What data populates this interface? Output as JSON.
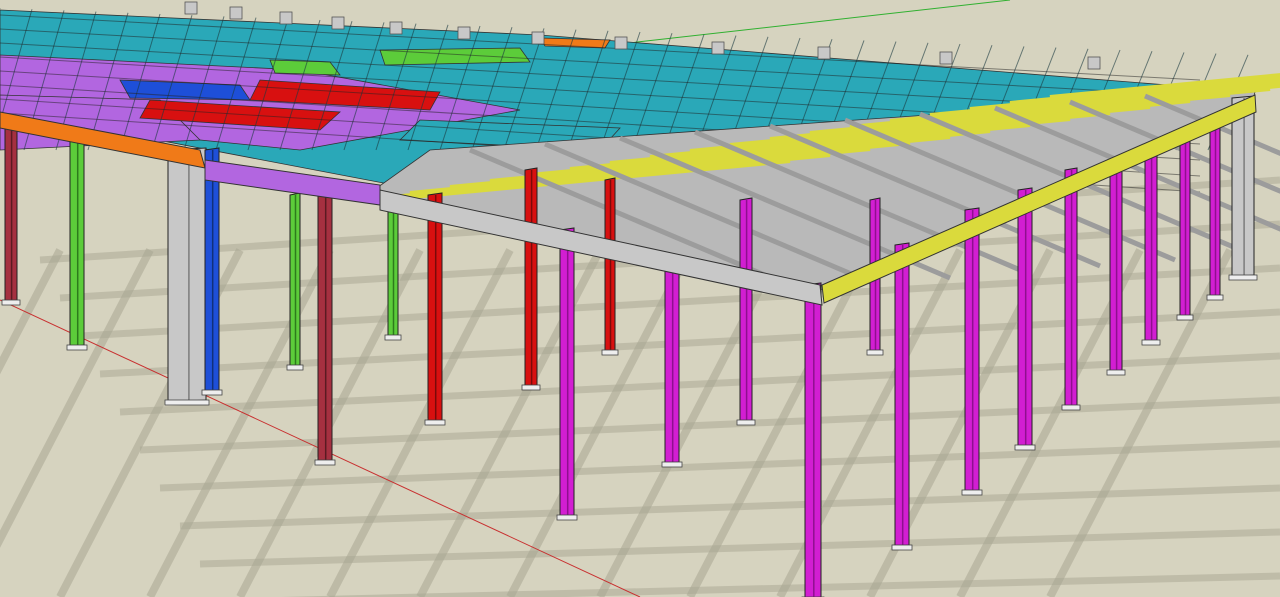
{
  "viewport": {
    "background": "#d6d3bf",
    "shadow_color": "#a9a793"
  },
  "palette": {
    "magenta": "#d21ed2",
    "magenta_dark": "#8f0f8f",
    "yellow": "#dada3c",
    "yellow_dark": "#9a9a20",
    "grey": "#c8c8c8",
    "grey_dark": "#7c7c7c",
    "red": "#d81010",
    "maroon": "#a53040",
    "green": "#5ccc3a",
    "blue": "#1e4fd8",
    "orange": "#f07a18",
    "cyan": "#2aa8b8",
    "purple": "#b266e0",
    "axis_red": "#c83030",
    "axis_green": "#30b030"
  }
}
